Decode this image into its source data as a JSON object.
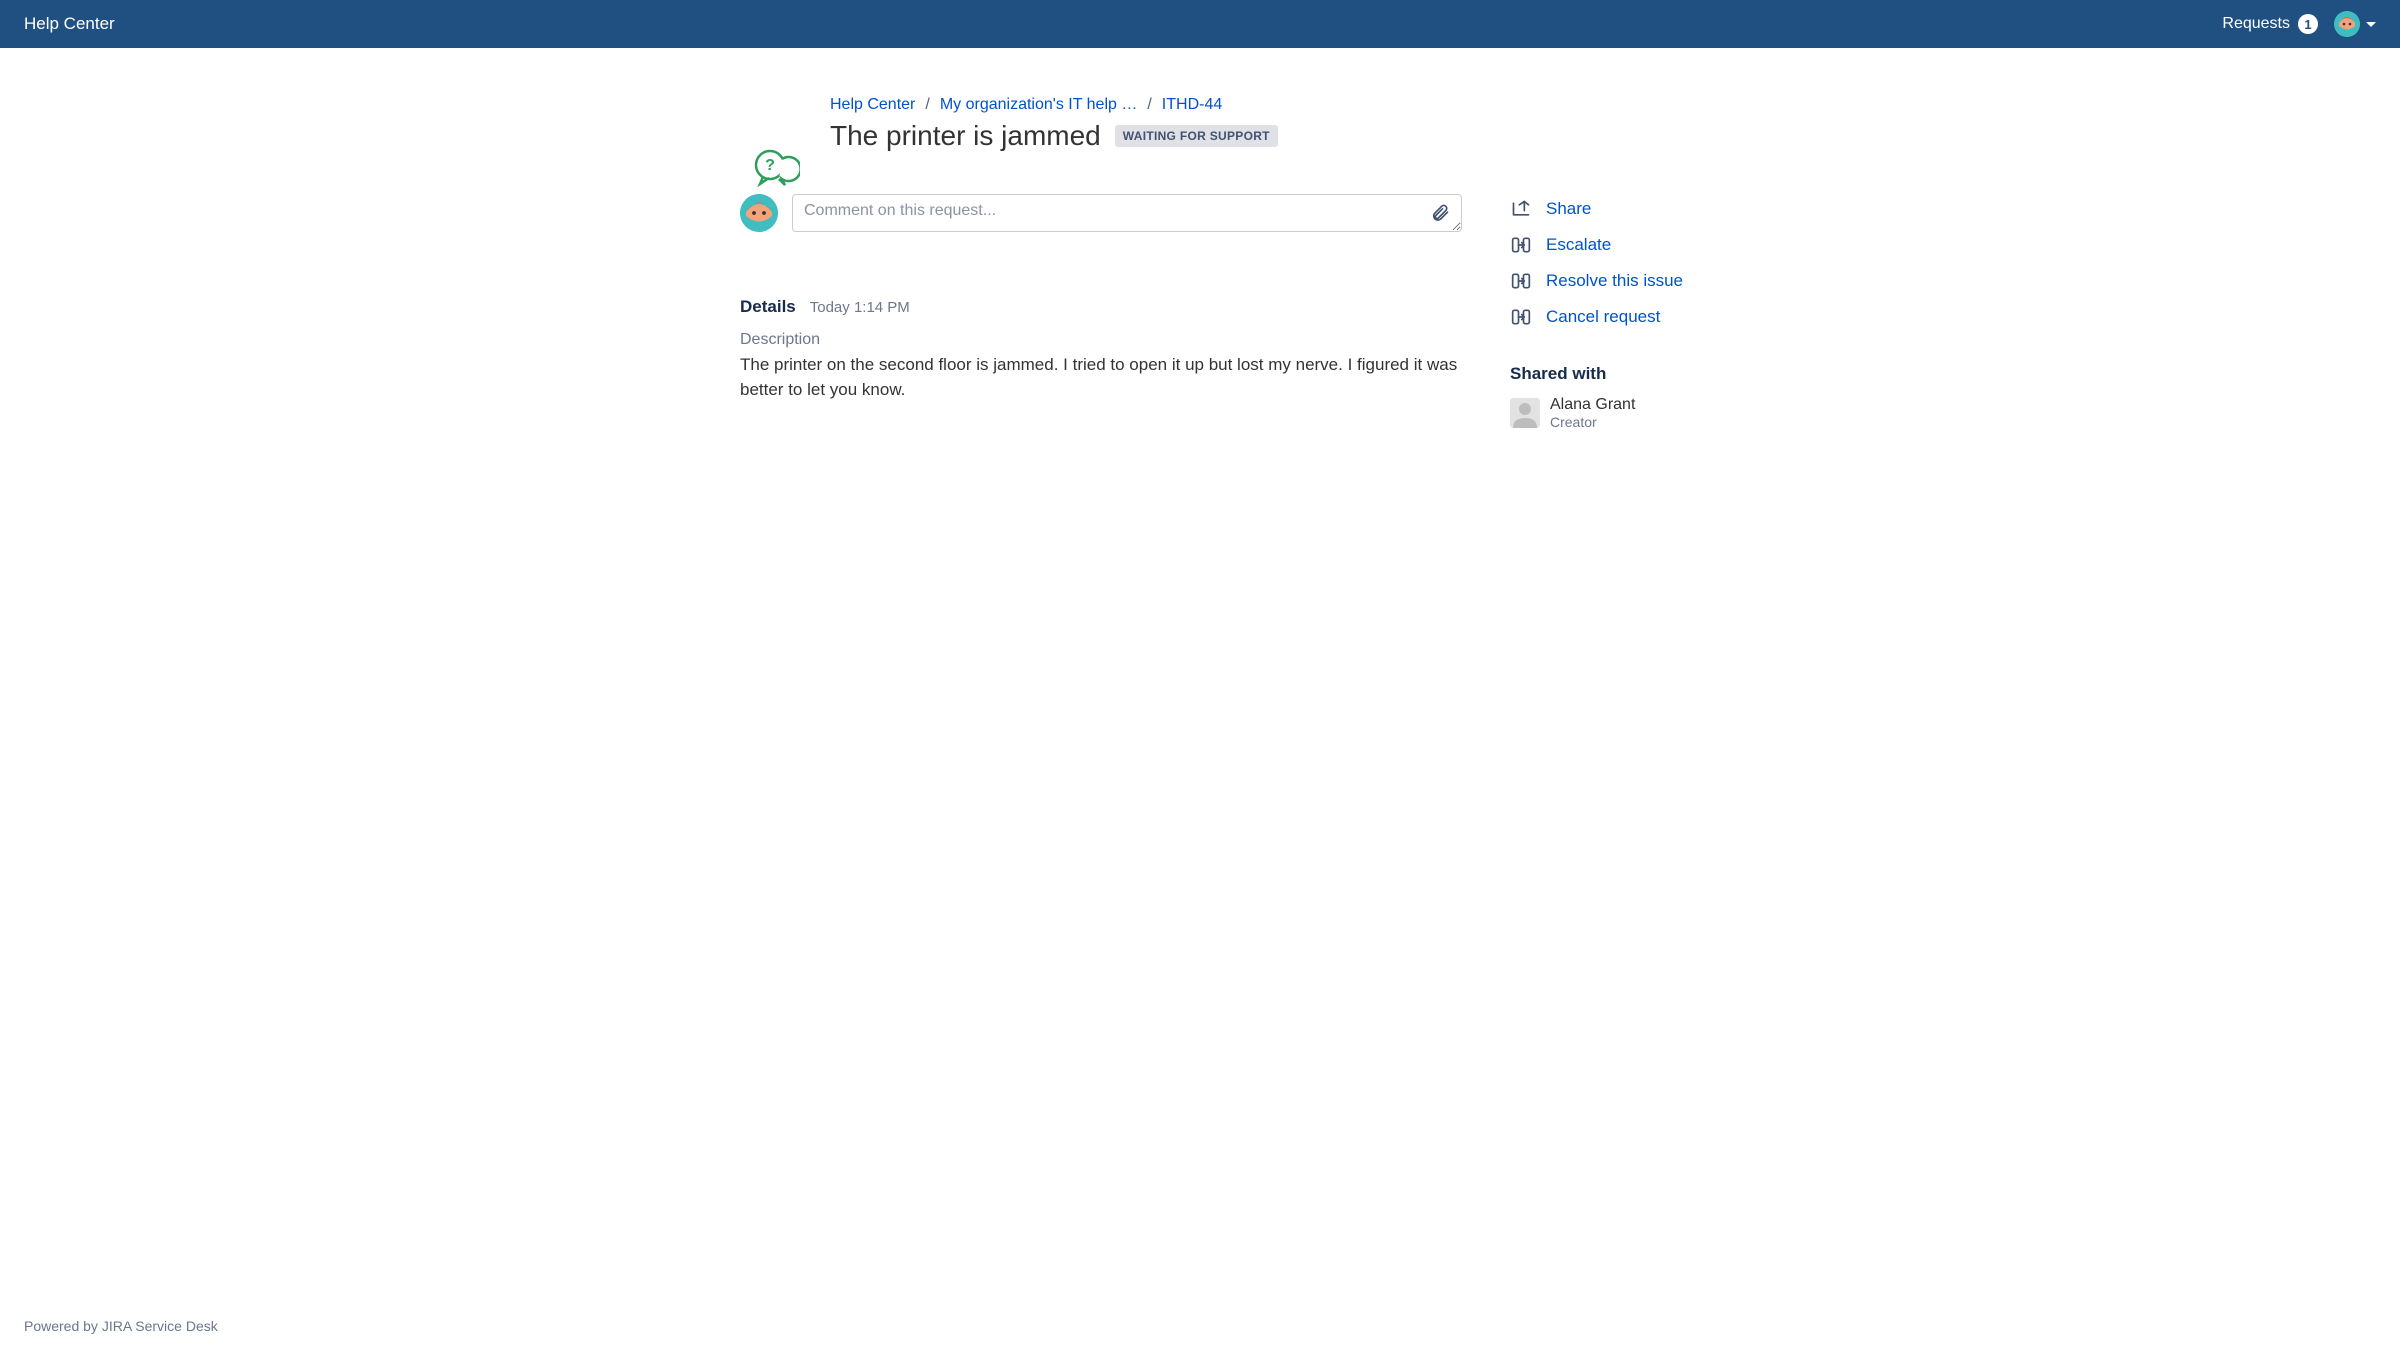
{
  "topbar": {
    "title": "Help Center",
    "requests_label": "Requests",
    "requests_count": "1"
  },
  "breadcrumbs": {
    "home": "Help Center",
    "project": "My organization's IT help …",
    "key": "ITHD-44"
  },
  "request": {
    "summary": "The printer is jammed",
    "status": "WAITING FOR SUPPORT"
  },
  "comment": {
    "placeholder": "Comment on this request..."
  },
  "details": {
    "heading": "Details",
    "timestamp": "Today 1:14 PM",
    "description_label": "Description",
    "description_value": "The printer on the second floor is jammed. I tried to open it up but lost my nerve. I figured it was better to let you know."
  },
  "actions": {
    "share": "Share",
    "escalate": "Escalate",
    "resolve": "Resolve this issue",
    "cancel": "Cancel request"
  },
  "shared_with": {
    "heading": "Shared with",
    "person_name": "Alana Grant",
    "person_role": "Creator"
  },
  "footer": {
    "text": "Powered by JIRA Service Desk"
  }
}
